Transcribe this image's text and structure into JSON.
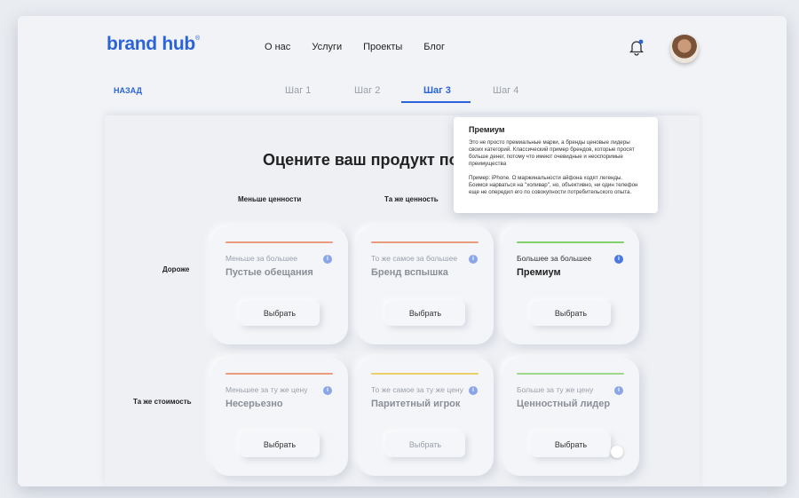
{
  "header": {
    "logo": "brand hub",
    "logo_mark": "®",
    "nav": [
      "О нас",
      "Услуги",
      "Проекты",
      "Блог"
    ]
  },
  "back_label": "НАЗАД",
  "steps": [
    "Шаг 1",
    "Шаг 2",
    "Шаг 3",
    "Шаг 4"
  ],
  "active_step": "Шаг 3",
  "title": "Оцените ваш продукт по ",
  "columns": [
    "Меньше ценности",
    "Та же ценность"
  ],
  "rows": [
    "Дороже",
    "Та же стоимость"
  ],
  "cards": [
    {
      "sub": "Меньше за большее",
      "name": "Пустые обещания",
      "button": "Выбрать",
      "accent": "#ec9a7c"
    },
    {
      "sub": "То же самое за большее",
      "name": "Бренд вспышка",
      "button": "Выбрать",
      "accent": "#ec9a7c"
    },
    {
      "sub": "Большее за большее",
      "name": "Премиум",
      "button": "Выбрать",
      "accent": "#7fcf6a"
    },
    {
      "sub": "Меньшее за ту же цену",
      "name": "Несерьезно",
      "button": "Выбрать",
      "accent": "#ec9a7c"
    },
    {
      "sub": "То же самое за ту же цену",
      "name": "Паритетный игрок",
      "button": "Выбрать",
      "accent": "#e8cf6a"
    },
    {
      "sub": "Больше за ту же цену",
      "name": "Ценностный лидер",
      "button": "Выбрать",
      "accent": "#9ed98a"
    }
  ],
  "tooltip": {
    "title": "Премиум",
    "p1": "Это не просто премиальные марки, а бренды ценовые лидеры своих категорий. Классический пример брендов, которые просят больше денег, потому что имеют очевидные и неоспоримые преимущества",
    "p2": "Пример: iPhone. О маржинальности айфона ходят легенды. Боимся нарваться на \"холивар\", но, объективно, ни один телефон еще не опередил его по совокупности потребительского опыта."
  },
  "colors": {
    "brand": "#2b63d9",
    "info": "#8aa5e8"
  }
}
